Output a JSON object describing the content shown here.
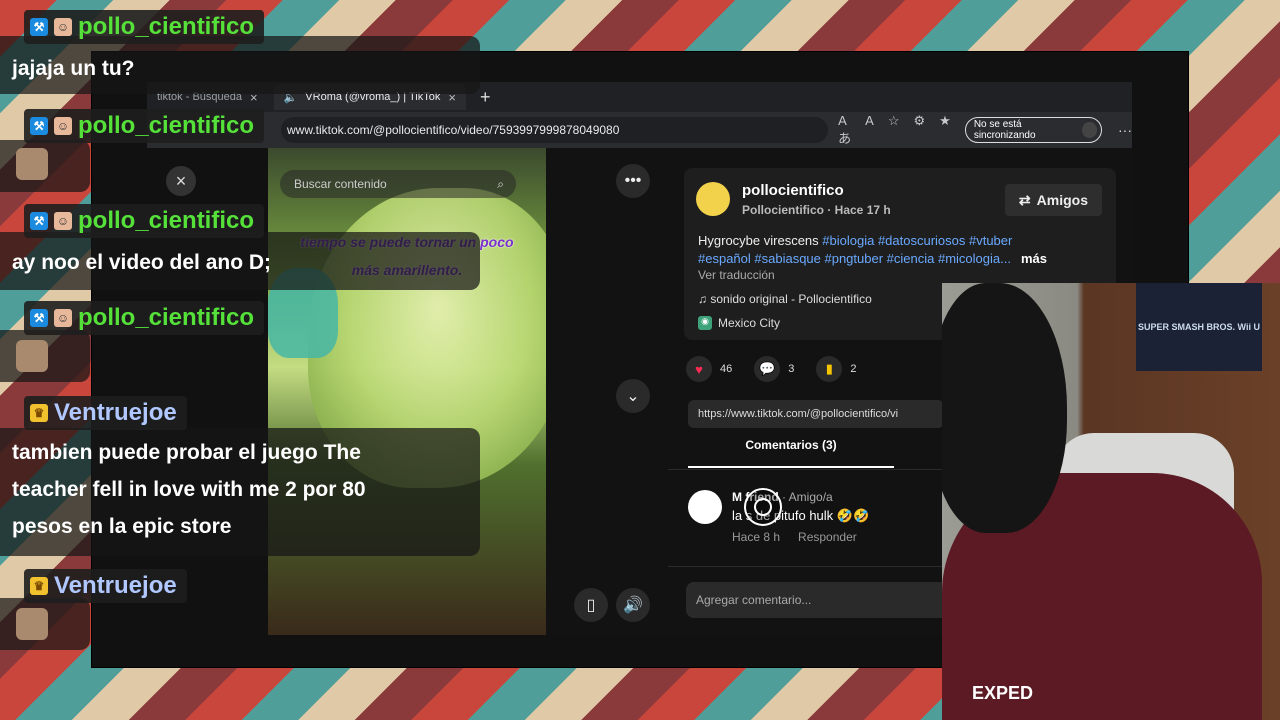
{
  "browser": {
    "tabs": [
      {
        "label": "tiktok - Búsqueda"
      },
      {
        "label": "VRoma (@vroma_) | TikTok"
      }
    ],
    "url": "www.tiktok.com/@pollocientifico/video/7593997999878049080",
    "sync_label": "No se está sincronizando"
  },
  "video": {
    "search_placeholder": "Buscar contenido",
    "caption_line1": "tiempo se puede tornar un poco",
    "caption_line2": "más amarillento."
  },
  "post": {
    "author": "pollocientifico",
    "author_sub": "Pollocientifico · Hace 17 h",
    "friends_button": "Amigos",
    "desc_text": "Hygrocybe virescens ",
    "tags_line1": "#biologia #datoscuriosos #vtuber",
    "tags_line2": "#español #sabiasque #pngtuber #ciencia #micologia...",
    "more": "más",
    "translate": "Ver traducción",
    "sound": "sonido original - Pollocientifico",
    "location": "Mexico City",
    "likes": "46",
    "comments": "3",
    "saves": "2",
    "share_url": "https://www.tiktok.com/@pollocientifico/vi",
    "comments_tab": "Comentarios (3)",
    "comment": {
      "name": "M    friend",
      "sub": " · Amigo/a",
      "text": "la     s de pitufo hulk 🤣🤣",
      "time": "Hace 8 h",
      "reply": "Responder"
    },
    "add_comment_placeholder": "Agregar comentario..."
  },
  "webcam": {
    "poster_text": "SUPER SMASH BROS. Wii U",
    "shirt_text": "EXPED"
  },
  "chat": [
    {
      "user": "pollo_cientifico",
      "message": "jajaja un tu?"
    },
    {
      "user": "pollo_cientifico",
      "message": ""
    },
    {
      "user": "pollo_cientifico",
      "message": "ay noo el video del ano D;"
    },
    {
      "user": "pollo_cientifico",
      "message": ""
    },
    {
      "user": "Ventruejoe",
      "message_line1": "tambien puede probar el juego The",
      "message_line2": "teacher fell in love with me 2 por 80",
      "message_line3": "pesos en la epic store"
    },
    {
      "user": "Ventruejoe",
      "message": ""
    }
  ],
  "colors": {
    "username_green": "#55e03a",
    "username_blue": "#b0c8ff",
    "tiktok_red": "#fe2c55",
    "hashtag_blue": "#6aa9ff"
  }
}
